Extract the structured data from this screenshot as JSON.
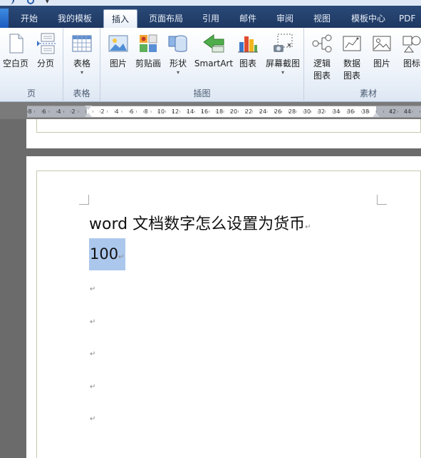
{
  "tabs": [
    {
      "label": "开始"
    },
    {
      "label": "我的模板"
    },
    {
      "label": "插入"
    },
    {
      "label": "页面布局"
    },
    {
      "label": "引用"
    },
    {
      "label": "邮件"
    },
    {
      "label": "审阅"
    },
    {
      "label": "视图"
    },
    {
      "label": "模板中心"
    },
    {
      "label": "PDF"
    }
  ],
  "ribbon": {
    "groups": [
      {
        "label": "页",
        "buttons": [
          {
            "label": "空白页",
            "icon": "blank-page-icon"
          },
          {
            "label": "分页",
            "icon": "page-break-icon"
          }
        ]
      },
      {
        "label": "表格",
        "buttons": [
          {
            "label": "表格",
            "icon": "table-icon"
          }
        ]
      },
      {
        "label": "插图",
        "buttons": [
          {
            "label": "图片",
            "icon": "picture-icon"
          },
          {
            "label": "剪贴画",
            "icon": "clip-art-icon"
          },
          {
            "label": "形状",
            "icon": "shapes-icon"
          },
          {
            "label": "SmartArt",
            "icon": "smartart-icon"
          },
          {
            "label": "图表",
            "icon": "chart-icon"
          },
          {
            "label": "屏幕截图",
            "icon": "screenshot-icon"
          }
        ]
      },
      {
        "label": "素材",
        "buttons": [
          {
            "label": "逻辑\n图表",
            "icon": "logic-chart-icon"
          },
          {
            "label": "数据\n图表",
            "icon": "data-chart-icon"
          },
          {
            "label": "图片",
            "icon": "material-picture-icon"
          },
          {
            "label": "图标",
            "icon": "material-icon-icon"
          }
        ]
      }
    ]
  },
  "ruler": {
    "numbers": [
      "8",
      "6",
      "4",
      "2",
      "2",
      "4",
      "6",
      "8",
      "10",
      "12",
      "14",
      "16",
      "18",
      "20",
      "22",
      "24",
      "26",
      "28",
      "30",
      "32",
      "34",
      "36",
      "38",
      "42",
      "44"
    ]
  },
  "document": {
    "title_line": "word 文档数字怎么设置为货币",
    "selected_value": "100",
    "paragraph_mark": "↵"
  },
  "colors": {
    "tab_bar": "#2b4a78",
    "selection": "#abc7ec",
    "page_border": "#c6c8b0"
  }
}
